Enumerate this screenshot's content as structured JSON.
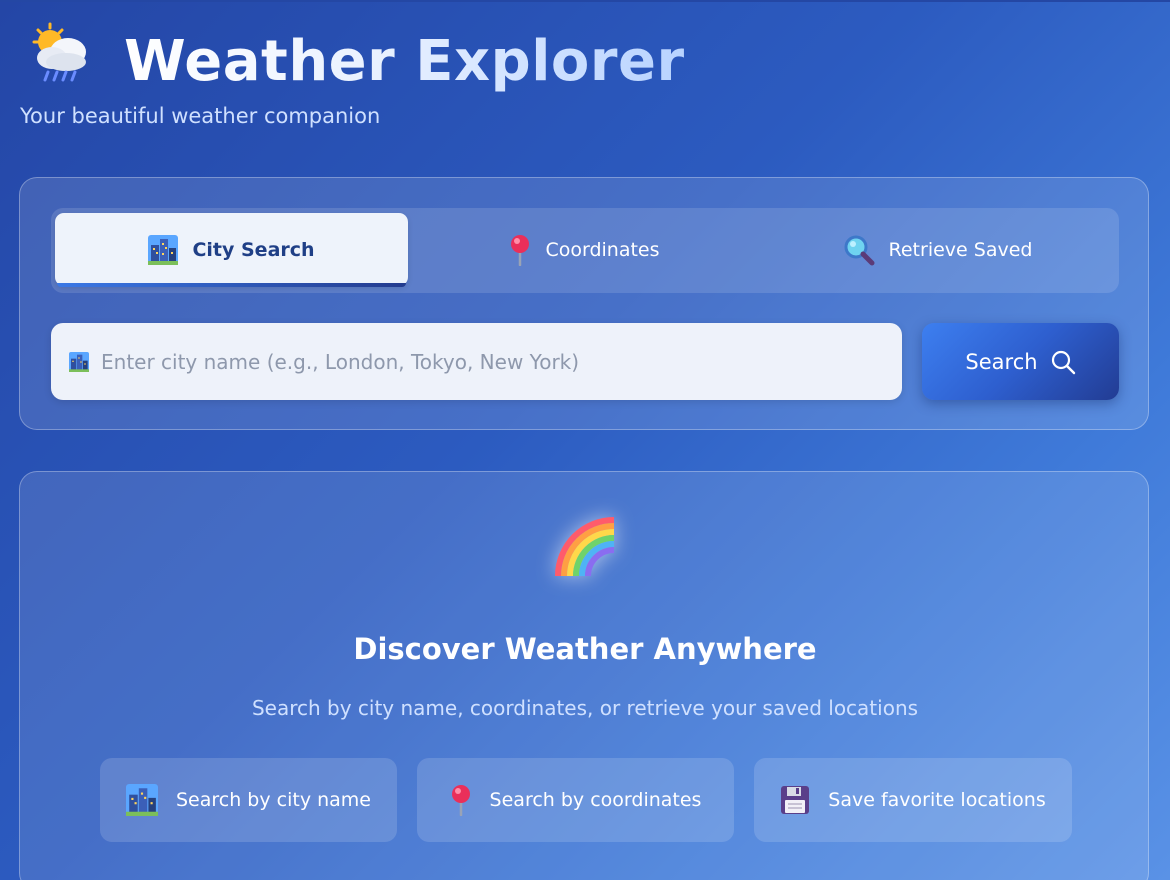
{
  "app": {
    "title": "Weather Explorer",
    "subtitle": "Your beautiful weather companion",
    "logo_icon": "sun-behind-rain-cloud-icon"
  },
  "search_panel": {
    "tabs": [
      {
        "label": "City Search",
        "icon": "cityscape-icon",
        "active": true
      },
      {
        "label": "Coordinates",
        "icon": "round-pushpin-icon",
        "active": false
      },
      {
        "label": "Retrieve Saved",
        "icon": "magnifying-glass-icon",
        "active": false
      }
    ],
    "input": {
      "value": "",
      "placeholder": "Enter city name (e.g., London, Tokyo, New York)",
      "icon": "cityscape-icon"
    },
    "search_button": {
      "label": "Search",
      "icon": "search-icon"
    }
  },
  "welcome": {
    "icon": "rainbow-icon",
    "title": "Discover Weather Anywhere",
    "subtitle": "Search by city name, coordinates, or retrieve your saved locations",
    "features": [
      {
        "label": "Search by city name",
        "icon": "cityscape-icon"
      },
      {
        "label": "Search by coordinates",
        "icon": "round-pushpin-icon"
      },
      {
        "label": "Save favorite locations",
        "icon": "floppy-disk-icon"
      }
    ]
  },
  "colors": {
    "background_start": "#2446a6",
    "background_end": "#5a92e6",
    "active_tab_bg": "#eef3fb",
    "active_tab_text": "#1f3f86",
    "button_start": "#3d7ff0",
    "button_end": "#223c93"
  }
}
